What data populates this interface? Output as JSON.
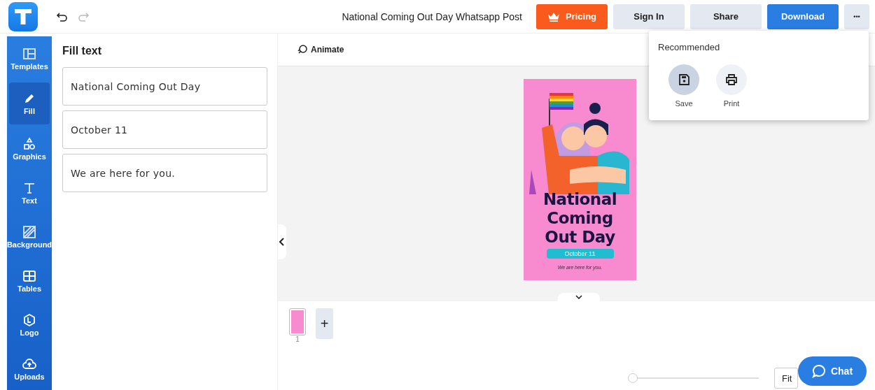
{
  "header": {
    "undo": {
      "disabled": false
    },
    "redo": {
      "disabled": true
    },
    "title": "National Coming Out Day Whatsapp Post",
    "buttons": [
      {
        "kind": "pricing",
        "label": "Pricing"
      },
      {
        "kind": "plain",
        "label": "Sign In"
      },
      {
        "kind": "plain",
        "label": "Share"
      },
      {
        "kind": "primary",
        "label": "Download"
      },
      {
        "kind": "more",
        "label": "•••"
      }
    ]
  },
  "sidebar": {
    "items": [
      {
        "label": "Templates",
        "selected": false
      },
      {
        "label": "Fill",
        "selected": true
      },
      {
        "label": "Graphics",
        "selected": false
      },
      {
        "label": "Text",
        "selected": false
      },
      {
        "label": "Background",
        "selected": false
      },
      {
        "label": "Tables",
        "selected": false
      },
      {
        "label": "Logo",
        "selected": false
      },
      {
        "label": "Uploads",
        "selected": false
      }
    ]
  },
  "fill_panel": {
    "title": "Fill text",
    "fields": [
      "National Coming Out Day",
      "October 11",
      "We are here for you."
    ]
  },
  "toolbar": {
    "animate": "Animate"
  },
  "poster": {
    "title": "National Coming Out Day",
    "date": "October 11",
    "tagline": "We are here for you."
  },
  "pages": [
    {
      "number": "1",
      "selected": true
    }
  ],
  "add_page": "+",
  "zoom": {
    "level": 0,
    "fit": "Fit"
  },
  "chat": "Chat",
  "menu": {
    "heading": "Recommended",
    "items": [
      {
        "label": "Save",
        "selected": true
      },
      {
        "label": "Print",
        "selected": false
      }
    ]
  }
}
